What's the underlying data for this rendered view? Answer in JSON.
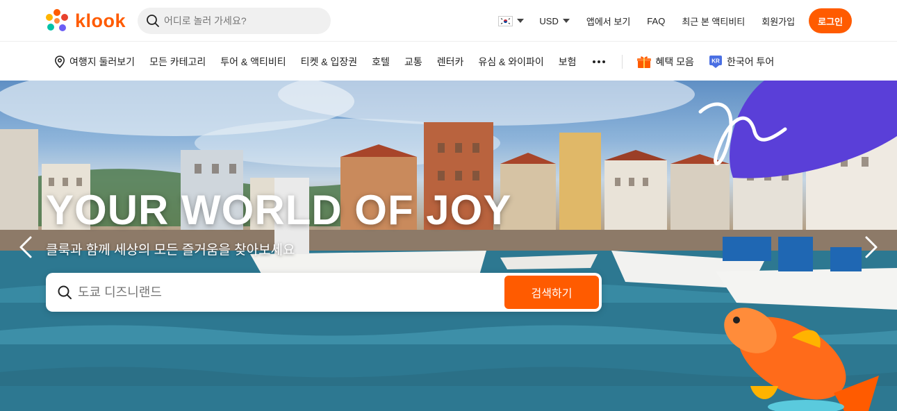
{
  "brand": {
    "name": "klook",
    "accent": "#ff5b00",
    "deco_purple": "#5a3fd8"
  },
  "header": {
    "search_placeholder": "어디로 놀러 가세요?",
    "language_flag": "kr-flag-icon",
    "currency": "USD",
    "links": [
      "앱에서 보기",
      "FAQ",
      "최근 본 액티비티",
      "회원가입"
    ],
    "login_label": "로그인"
  },
  "nav": {
    "explore_label": "여행지 둘러보기",
    "items": [
      "모든 카테고리",
      "투어 & 액티비티",
      "티켓 & 입장권",
      "호텔",
      "교통",
      "렌터카",
      "유심 & 와이파이",
      "보험"
    ],
    "more_icon": "more-dots-icon",
    "promo_label": "혜택 모음",
    "korean_tour_label": "한국어 투어",
    "korean_tour_badge": "KR"
  },
  "hero": {
    "title": "YOUR WORLD OF JOY",
    "subtitle": "클룩과 함께 세상의 모든 즐거움을 찾아보세요",
    "search_placeholder": "도쿄 디즈니랜드",
    "search_button": "검색하기"
  }
}
